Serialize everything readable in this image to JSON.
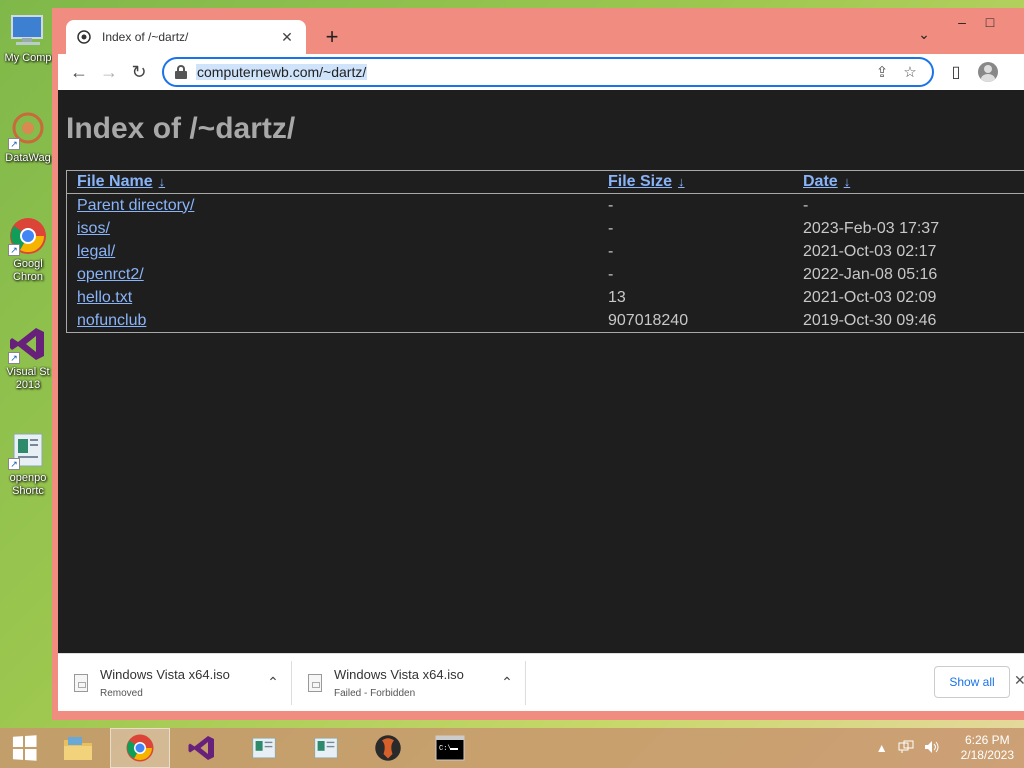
{
  "desktop": {
    "icons": [
      {
        "label": "My Comp"
      },
      {
        "label": "DataWag"
      },
      {
        "label": "Googl Chron"
      },
      {
        "label": "Visual St 2013"
      },
      {
        "label": "openpo Shortc"
      }
    ]
  },
  "browser": {
    "tab": {
      "title": "Index of /~dartz/",
      "close": "✕"
    },
    "new_tab": "+",
    "tab_list": "⌄",
    "window_controls": {
      "minimize": "–",
      "maximize": "□"
    },
    "nav": {
      "back": "←",
      "forward": "→",
      "reload": "↻"
    },
    "address": {
      "url": "computernewb.com/~dartz/"
    },
    "omnibox_icons": {
      "share": "⇪",
      "bookmark": "☆"
    },
    "side_panel": "▯"
  },
  "page": {
    "heading": "Index of /~dartz/",
    "columns": {
      "name": "File Name",
      "size": "File Size",
      "date": "Date",
      "sort_glyph": "↓"
    },
    "rows": [
      {
        "name": "Parent directory/",
        "size": "-",
        "date": "-"
      },
      {
        "name": "isos/",
        "size": "-",
        "date": "2023-Feb-03 17:37"
      },
      {
        "name": "legal/",
        "size": "-",
        "date": "2021-Oct-03 02:17"
      },
      {
        "name": "openrct2/",
        "size": "-",
        "date": "2022-Jan-08 05:16"
      },
      {
        "name": "hello.txt",
        "size": "13",
        "date": "2021-Oct-03 02:09"
      },
      {
        "name": "nofunclub",
        "size": "907018240",
        "date": "2019-Oct-30 09:46"
      }
    ]
  },
  "downloads": {
    "items": [
      {
        "name": "Windows Vista x64.iso",
        "status": "Removed"
      },
      {
        "name": "Windows Vista x64.iso",
        "status": "Failed - Forbidden"
      }
    ],
    "chevron": "⌃",
    "show_all": "Show all",
    "close": "✕"
  },
  "taskbar": {
    "tray_chevron": "▲",
    "clock": {
      "time": "6:26 PM",
      "date": "2/18/2023"
    }
  },
  "colors": {
    "window_frame": "#f08c80",
    "page_bg": "#1e1e1e",
    "link": "#8ab4f8",
    "omnibox_border": "#1a73e8"
  }
}
